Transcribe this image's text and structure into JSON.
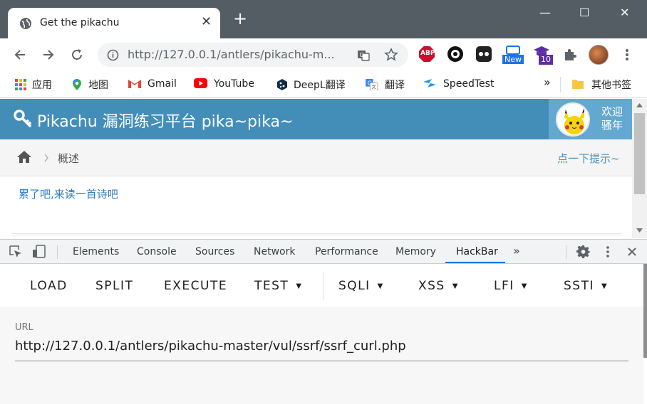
{
  "browser": {
    "tab_title": "Get the pikachu",
    "tab_close": "✕",
    "new_tab": "+",
    "url": "http://127.0.0.1/antlers/pikachu-m...",
    "win_min": "—",
    "win_max": "☐",
    "win_close": "✕",
    "ext_abp": "ABP",
    "ext_new": "New",
    "ext_badge": "10"
  },
  "bookmarks": {
    "items": [
      {
        "label": "应用",
        "icon": "apps-grid-icon",
        "color": "#ea4335"
      },
      {
        "label": "地图",
        "icon": "maps-pin-icon",
        "color": "#34a853"
      },
      {
        "label": "Gmail",
        "icon": "gmail-icon",
        "color": "#ea4335"
      },
      {
        "label": "YouTube",
        "icon": "youtube-icon",
        "color": "#ff0000"
      },
      {
        "label": "DeepL翻译",
        "icon": "deepl-icon",
        "color": "#0f2b46"
      },
      {
        "label": "翻译",
        "icon": "translate-icon",
        "color": "#4285f4"
      },
      {
        "label": "SpeedTest",
        "icon": "speedtest-icon",
        "color": "#1a9be6"
      }
    ],
    "more": "»",
    "other_label": "其他书签"
  },
  "page": {
    "title": "Pikachu 漏洞练习平台 pika~pika~",
    "welcome_line1": "欢迎",
    "welcome_line2": "骚年",
    "breadcrumb_label": "概述",
    "hint_link": "点一下提示~",
    "poem_link": "累了吧,来读一首诗吧",
    "header_color": "#438eb9"
  },
  "devtools": {
    "tabs": [
      "Elements",
      "Console",
      "Sources",
      "Network",
      "Performance",
      "Memory",
      "HackBar"
    ],
    "active_tab": "HackBar",
    "more": "»"
  },
  "hackbar": {
    "buttons": [
      "LOAD",
      "SPLIT",
      "EXECUTE",
      "TEST",
      "SQLI",
      "XSS",
      "LFI",
      "SSTI"
    ],
    "url_label": "URL",
    "url_value": "http://127.0.0.1/antlers/pikachu-master/vul/ssrf/ssrf_curl.php"
  }
}
